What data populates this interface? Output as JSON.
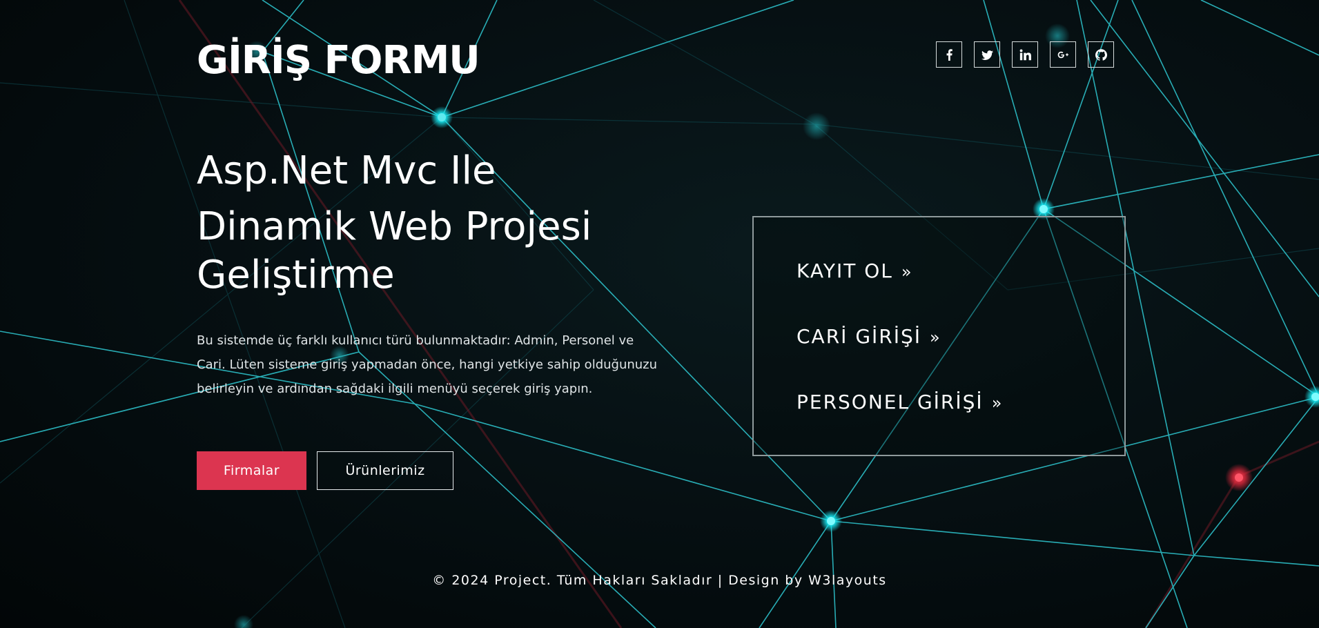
{
  "site": {
    "title": "GİRİŞ FORMU"
  },
  "social": [
    {
      "icon": "facebook-icon"
    },
    {
      "icon": "twitter-icon"
    },
    {
      "icon": "linkedin-icon"
    },
    {
      "icon": "google-plus-icon"
    },
    {
      "icon": "github-icon"
    }
  ],
  "hero": {
    "headline_line1": "Asp.Net Mvc Ile",
    "headline_line2": "Dinamik Web Projesi",
    "headline_line3": "Geliştirme",
    "description": "Bu sistemde üç farklı kullanıcı türü bulunmaktadır: Admin, Personel ve Cari. Lüten sisteme giriş yapmadan önce, hangi yetkiye sahip olduğunuzu belirleyin ve ardından sağdaki ilgili menüyü seçerek giriş yapın.",
    "primary_button": "Firmalar",
    "secondary_button": "Ürünlerimiz"
  },
  "login_menu": {
    "items": [
      {
        "label": "KAYIT OL",
        "arrow": "»"
      },
      {
        "label": "CARİ GİRİŞİ",
        "arrow": "»"
      },
      {
        "label": "PERSONEL GİRİŞİ",
        "arrow": "»"
      }
    ]
  },
  "footer": {
    "copyright": "© 2024 Project. Tüm Hakları Sakladır | Design by W3layouts"
  },
  "colors": {
    "background": "#04090b",
    "accent": "#dc3550",
    "network_line": "#2fc9d2",
    "network_node": "#18f0f5",
    "network_red": "#e0283c"
  }
}
